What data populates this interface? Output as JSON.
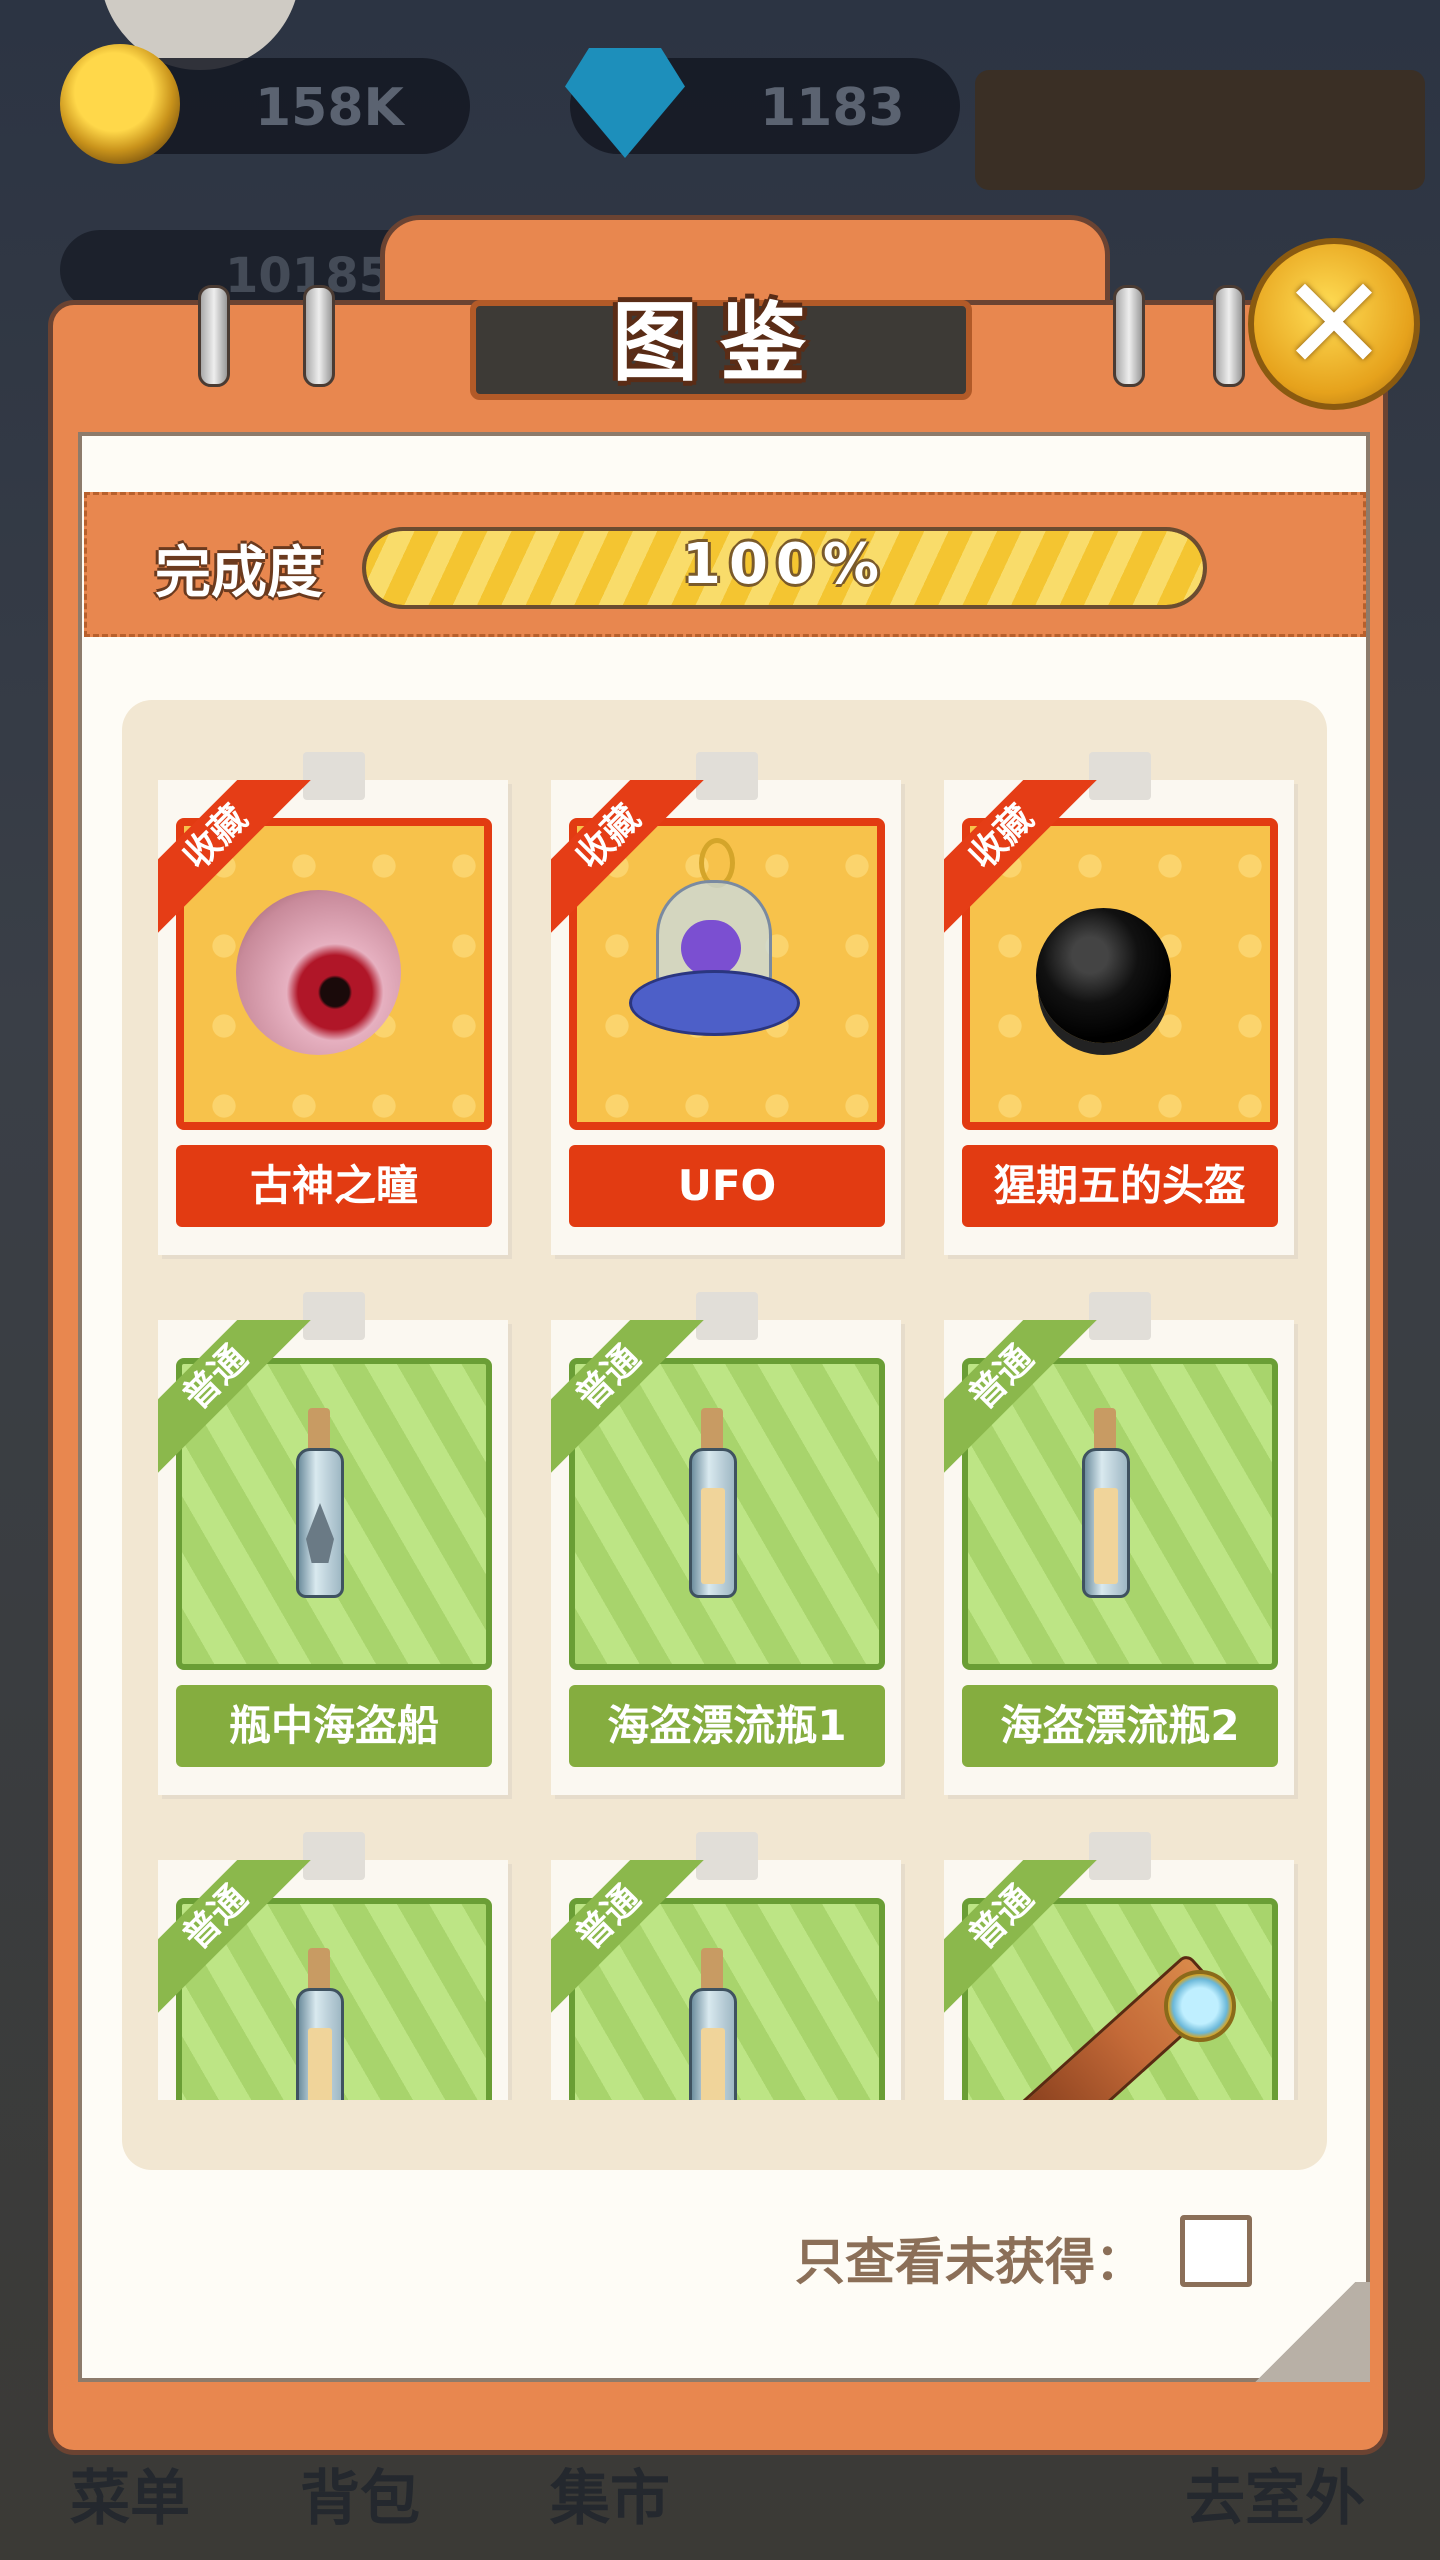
{
  "hud": {
    "coins": "158K",
    "gems": "1183",
    "level_value": "10185"
  },
  "bottom_menu": [
    "菜单",
    "背包",
    "集市",
    "去室外"
  ],
  "dialog": {
    "title": "图鉴",
    "close_icon": "close-x-icon",
    "progress": {
      "label": "完成度",
      "value_text": "100%",
      "fraction": 1.0
    },
    "filter": {
      "label": "只查看未获得：",
      "checked": false
    },
    "items": [
      {
        "name": "古神之瞳",
        "tag": "收藏",
        "rarity": "rare",
        "icon": "eye-icon"
      },
      {
        "name": "UFO",
        "tag": "收藏",
        "rarity": "rare",
        "icon": "ufo-icon"
      },
      {
        "name": "猩期五的头盔",
        "tag": "收藏",
        "rarity": "rare",
        "icon": "helmet-icon"
      },
      {
        "name": "瓶中海盗船",
        "tag": "普通",
        "rarity": "common",
        "icon": "ship-bottle-icon"
      },
      {
        "name": "海盗漂流瓶1",
        "tag": "普通",
        "rarity": "common",
        "icon": "bottle-icon"
      },
      {
        "name": "海盗漂流瓶2",
        "tag": "普通",
        "rarity": "common",
        "icon": "bottle-icon"
      },
      {
        "name": "",
        "tag": "普通",
        "rarity": "common",
        "icon": "bottle-icon"
      },
      {
        "name": "",
        "tag": "普通",
        "rarity": "common",
        "icon": "bottle-icon"
      },
      {
        "name": "",
        "tag": "普通",
        "rarity": "common",
        "icon": "telescope-icon"
      }
    ]
  },
  "colors": {
    "dialog_orange": "#e8874f",
    "rare_red": "#e23b12",
    "common_green": "#85ad3f",
    "progress_yellow": "#f4c531"
  }
}
